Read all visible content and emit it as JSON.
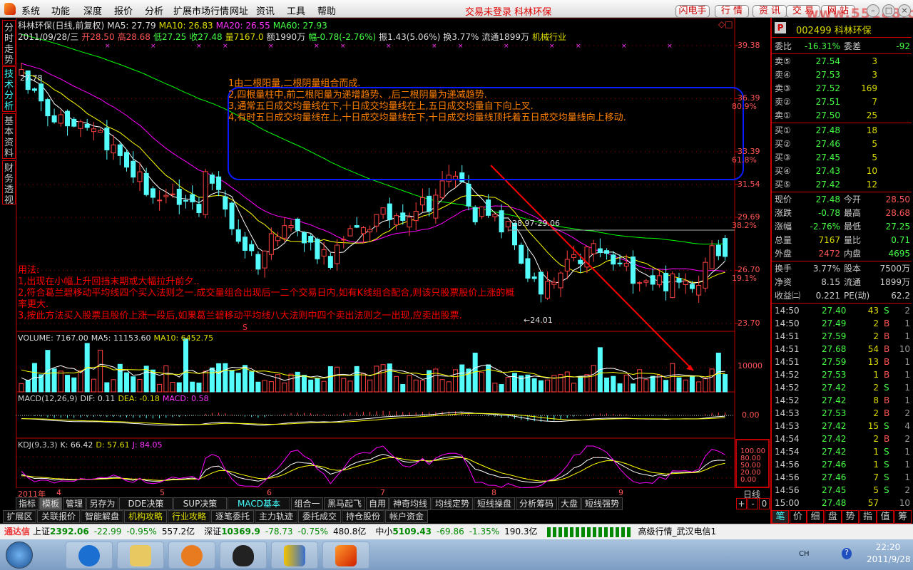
{
  "menu": {
    "items": [
      "系统",
      "功能",
      "深度",
      "报价",
      "分析",
      "扩展市场行情",
      "网址",
      "资讯",
      "工具",
      "帮助"
    ],
    "login_status": "交易未登录  科林环保",
    "buttons": [
      "闪电手",
      "行  情",
      "资  讯",
      "交  易",
      "网  站"
    ],
    "watermark": "www.55188.com"
  },
  "left_tabs": [
    "分时走势",
    "技术分析",
    "基本资料",
    "财务透视"
  ],
  "chart_header": {
    "line1": [
      {
        "t": "科林环保(日线,前复权)",
        "c": "wh"
      },
      {
        "t": "MA5: 27.79",
        "c": "wh"
      },
      {
        "t": "MA10: 26.83",
        "c": "ye"
      },
      {
        "t": "MA20: 26.55",
        "c": "mg"
      },
      {
        "t": "MA60: 27.93",
        "c": "gr"
      }
    ],
    "line2": [
      {
        "t": "2011/09/28/三",
        "c": "wh"
      },
      {
        "t": "开28.50",
        "c": "rd"
      },
      {
        "t": "高28.68",
        "c": "rd"
      },
      {
        "t": "低27.25",
        "c": "gr"
      },
      {
        "t": "收27.48",
        "c": "gr"
      },
      {
        "t": "量7167.0",
        "c": "ye"
      },
      {
        "t": "额1990万",
        "c": "wh"
      },
      {
        "t": "幅-0.78(-2.76%)",
        "c": "gr"
      },
      {
        "t": "振1.43(5.06%)",
        "c": "wh"
      },
      {
        "t": "换3.77%",
        "c": "wh"
      },
      {
        "t": "流通1899万",
        "c": "wh"
      },
      {
        "t": "机械行业",
        "c": "ye"
      }
    ]
  },
  "price_axis": [
    {
      "v": "39.38"
    },
    {
      "v": "36.39",
      "pct": "80.9%"
    },
    {
      "v": "33.39",
      "pct": "61.8%"
    },
    {
      "v": "31.54"
    },
    {
      "v": "29.69",
      "pct": "38.2%"
    },
    {
      "v": "26.70",
      "pct": "19.1%"
    },
    {
      "v": "23.70"
    }
  ],
  "chart_labels": {
    "high_mark": "27.78",
    "range_mark": "28.97-29.06",
    "low_mark": "←24.01",
    "s_mark": "S"
  },
  "notes_box": [
    "1由二根阳量,二根阴量组合而成.",
    "2,四根量柱中,前二根阳量为递增趋势、,后二根阴量为递减趋势.",
    "3,通常五日成交均量线在下,十日成交均量线在上,五日成交均量自下向上叉.",
    "4,有时五日成交均量线在上,十日成交均量线在下,十日成交均量线顶托着五日成交均量线向上移动."
  ],
  "usage_notes": [
    "用法:",
    "1,出现在小幅上升回挡末期或大幅拉升前夕..",
    "2,符合葛兰碧移动平均线四个买入法则之一.成交量组合出现后一二个交易日内,如有K线组合配合,则该只股票股价上涨的概",
    "率更大.",
    "3,按此方法买入股票且股价上涨一段后,如果葛兰碧移动平均线八大法则中四个卖出法则之一出现,应卖出股票."
  ],
  "volume_panel": {
    "label": "VOLUME: 7167.00",
    "ma5": "MA5: 11153.60",
    "ma10": "MA10: 6452.75",
    "axis": "10000"
  },
  "macd_panel": {
    "label": "MACD(12,26,9)",
    "dif": "DIF: 0.11",
    "dea": "DEA: -0.18",
    "macd": "MACD: 0.58",
    "axis": "0.00"
  },
  "kdj_panel": {
    "label": "KDJ(9,3,3)",
    "k": "K: 66.42",
    "d": "D: 57.61",
    "j": "J: 84.05",
    "axis": [
      "100.00",
      "80.00",
      "50.00",
      "20.00",
      "0.00"
    ]
  },
  "date_axis": {
    "year": "2011年",
    "months": [
      "4",
      "5",
      "6",
      "7",
      "8",
      "9"
    ],
    "period": "日线",
    "zoom_buttons": [
      "+",
      "-",
      "0"
    ]
  },
  "chart_data": {
    "type": "candlestick",
    "note": "approximate close keypoints (day index, price)",
    "keypoints": [
      [
        -60,
        42.5
      ],
      [
        -30,
        40
      ],
      [
        -10,
        38.5
      ],
      [
        0,
        37.5
      ],
      [
        5,
        35.5
      ],
      [
        11,
        35.0
      ],
      [
        14,
        33.5
      ],
      [
        21,
        30.5
      ],
      [
        27,
        30.3
      ],
      [
        28,
        32.5
      ],
      [
        33,
        28.5
      ],
      [
        36,
        27.2
      ],
      [
        40,
        29.8
      ],
      [
        43,
        28.3
      ],
      [
        47,
        27.4
      ],
      [
        52,
        29.3
      ],
      [
        58,
        30.0
      ],
      [
        62,
        30.6
      ],
      [
        66,
        32.2
      ],
      [
        69,
        30.0
      ],
      [
        74,
        29.0
      ],
      [
        77,
        26.5
      ],
      [
        79,
        25.2
      ],
      [
        83,
        26.8
      ],
      [
        87,
        28.0
      ],
      [
        91,
        26.8
      ],
      [
        96,
        26.2
      ],
      [
        100,
        25.9
      ],
      [
        103,
        26.3
      ],
      [
        105,
        28.5
      ],
      [
        107,
        27.48
      ]
    ],
    "ylim": [
      23.7,
      39.38
    ],
    "days": 108
  },
  "indicator_tabs": [
    "指标",
    "模板",
    "管理",
    "另存为",
    "DDE决策",
    "SUP决策",
    "MACD基本",
    "组合一",
    "黑马起飞",
    "自用",
    "神奇均线",
    "均线定势",
    "短线操盘",
    "分析筹码",
    "大盘",
    "短线强势"
  ],
  "bottom_tabs": [
    "扩展区",
    "关联报价",
    "智能解盘",
    "机构攻略",
    "行业攻略",
    "逐笔委托",
    "主力轨迹",
    "委托成交",
    "持仓股份",
    "帐户资金"
  ],
  "quote": {
    "flag": "P",
    "code": "002499",
    "name": "科林环保",
    "weibi": {
      "label": "委比",
      "value": "-16.31%",
      "diff_label": "委差",
      "diff": "-92"
    },
    "sell": [
      {
        "l": "卖⑤",
        "p": "27.54",
        "v": "3"
      },
      {
        "l": "卖④",
        "p": "27.53",
        "v": "3"
      },
      {
        "l": "卖③",
        "p": "27.52",
        "v": "169"
      },
      {
        "l": "卖②",
        "p": "27.51",
        "v": "7"
      },
      {
        "l": "卖①",
        "p": "27.50",
        "v": "25"
      }
    ],
    "buy": [
      {
        "l": "买①",
        "p": "27.48",
        "v": "18"
      },
      {
        "l": "买②",
        "p": "27.46",
        "v": "5"
      },
      {
        "l": "买③",
        "p": "27.45",
        "v": "5"
      },
      {
        "l": "买④",
        "p": "27.43",
        "v": "10"
      },
      {
        "l": "买⑤",
        "p": "27.42",
        "v": "12"
      }
    ],
    "stats": [
      [
        "现价",
        "27.48",
        "gr",
        "今开",
        "28.50",
        "rd"
      ],
      [
        "涨跌",
        "-0.78",
        "gr",
        "最高",
        "28.68",
        "rd"
      ],
      [
        "涨幅",
        "-2.76%",
        "gr",
        "最低",
        "27.25",
        "gr"
      ],
      [
        "总量",
        "7167",
        "ye",
        "量比",
        "0.71",
        "gr"
      ],
      [
        "外盘",
        "2472",
        "rd",
        "内盘",
        "4695",
        "gr"
      ]
    ],
    "fund": [
      [
        "换手",
        "3.77%",
        "股本",
        "7500万"
      ],
      [
        "净资",
        "8.15",
        "流通",
        "1899万"
      ],
      [
        "收益㈡",
        "0.221",
        "PE(动)",
        "62.2"
      ]
    ]
  },
  "ticks": [
    [
      "14:50",
      "27.40",
      "43",
      "S",
      "2"
    ],
    [
      "14:50",
      "27.49",
      "2",
      "B",
      "1"
    ],
    [
      "14:51",
      "27.59",
      "2",
      "B",
      "1"
    ],
    [
      "14:51",
      "27.68",
      "54",
      "B",
      "10"
    ],
    [
      "14:51",
      "27.59",
      "13",
      "B",
      "1"
    ],
    [
      "14:52",
      "27.53",
      "1",
      "B",
      "1"
    ],
    [
      "14:52",
      "27.42",
      "2",
      "S",
      "1"
    ],
    [
      "14:52",
      "27.42",
      "8",
      "B",
      "1"
    ],
    [
      "14:53",
      "27.53",
      "2",
      "B",
      "2"
    ],
    [
      "14:53",
      "27.42",
      "15",
      "S",
      "4"
    ],
    [
      "14:54",
      "27.42",
      "2",
      "B",
      "2"
    ],
    [
      "14:54",
      "27.42",
      "1",
      "S",
      "1"
    ],
    [
      "14:56",
      "27.46",
      "1",
      "S",
      "1"
    ],
    [
      "14:56",
      "27.46",
      "7",
      "S",
      "1"
    ],
    [
      "14:56",
      "27.45",
      "5",
      "S",
      "2"
    ],
    [
      "15:00",
      "27.48",
      "57",
      "",
      "10"
    ]
  ],
  "right_tabs": [
    "笔",
    "价",
    "细",
    "盘",
    "势",
    "指",
    "值",
    "筹"
  ],
  "status_bar": {
    "brand": "通达信",
    "sh": [
      "上证",
      "2392.06",
      "-22.99",
      "-0.95%",
      "557.2亿"
    ],
    "sz": [
      "深证",
      "10369.9",
      "-78.73",
      "-0.75%",
      "480.8亿"
    ],
    "zx": [
      "中小",
      "5109.43",
      "-69.86",
      "-1.35%",
      "190.3亿"
    ],
    "server": "高级行情_武汉电信1"
  },
  "taskbar": {
    "lang": "CH",
    "time": "22:20",
    "date": "2011/9/28"
  },
  "colors": {
    "up": "#ff4040",
    "down": "#54fcfc",
    "ma5": "#ffffff",
    "ma10": "#ffff00",
    "ma20": "#ff00ff",
    "ma60": "#00ff00",
    "grid": "#c00000"
  }
}
